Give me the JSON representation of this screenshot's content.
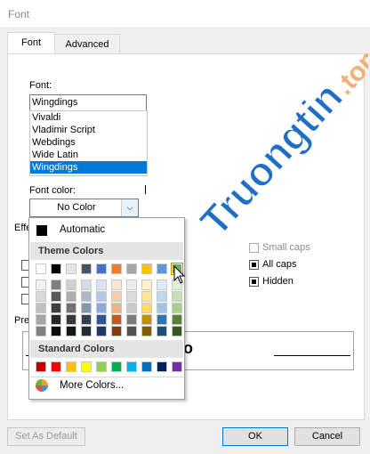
{
  "window": {
    "title": "Font"
  },
  "tabs": [
    {
      "label": "Font"
    },
    {
      "label": "Advanced"
    }
  ],
  "font_section": {
    "label": "Font:",
    "value": "Wingdings",
    "list": [
      "Vivaldi",
      "Vladimir Script",
      "Webdings",
      "Wide Latin",
      "Wingdings"
    ]
  },
  "font_color": {
    "label": "Font color:",
    "value": "No Color"
  },
  "effects": {
    "label": "Effe",
    "items": [
      {
        "label": "Small caps",
        "checked": false,
        "enabled": false
      },
      {
        "label": "All caps",
        "checked": true,
        "enabled": true
      },
      {
        "label": "Hidden",
        "checked": true,
        "enabled": true
      }
    ]
  },
  "preview": {
    "label": "Pre",
    "sample": "o"
  },
  "color_popup": {
    "automatic_label": "Automatic",
    "theme_header": "Theme Colors",
    "standard_header": "Standard Colors",
    "more_colors_label": "More Colors...",
    "theme_top": [
      "#ffffff",
      "#000000",
      "#e7e6e6",
      "#44546a",
      "#4472c4",
      "#ed7d31",
      "#a5a5a5",
      "#ffc000",
      "#5b9bd5",
      "#70ad47"
    ],
    "theme_shades": [
      [
        "#f2f2f2",
        "#7f7f7f",
        "#d0cece",
        "#d6dce4",
        "#dae3f3",
        "#fbe5d6",
        "#ededed",
        "#fff2cc",
        "#deebf7",
        "#e2f0d9"
      ],
      [
        "#d9d9d9",
        "#595959",
        "#aeabab",
        "#adb9ca",
        "#b4c7e7",
        "#f8cbad",
        "#dbdbdb",
        "#ffe699",
        "#bdd7ee",
        "#c5e0b4"
      ],
      [
        "#bfbfbf",
        "#404040",
        "#767171",
        "#8497b0",
        "#8faadc",
        "#f4b183",
        "#c9c9c9",
        "#ffd966",
        "#9dc3e6",
        "#a9d18e"
      ],
      [
        "#a6a6a6",
        "#262626",
        "#3b3838",
        "#333f50",
        "#2f5597",
        "#c55a11",
        "#7b7b7b",
        "#bf9000",
        "#2e75b6",
        "#548235"
      ],
      [
        "#808080",
        "#0d0d0d",
        "#171616",
        "#222a35",
        "#1f3864",
        "#843c0c",
        "#525252",
        "#7f6000",
        "#1f4e79",
        "#375623"
      ]
    ],
    "standard": [
      "#c00000",
      "#ff0000",
      "#ffc000",
      "#ffff00",
      "#92d050",
      "#00b050",
      "#00b0f0",
      "#0070c0",
      "#002060",
      "#7030a0"
    ]
  },
  "buttons": {
    "set_default": "Set As Default",
    "ok": "OK",
    "cancel": "Cancel"
  },
  "watermark": {
    "text": "Truongtin",
    "suffix": ".top"
  }
}
